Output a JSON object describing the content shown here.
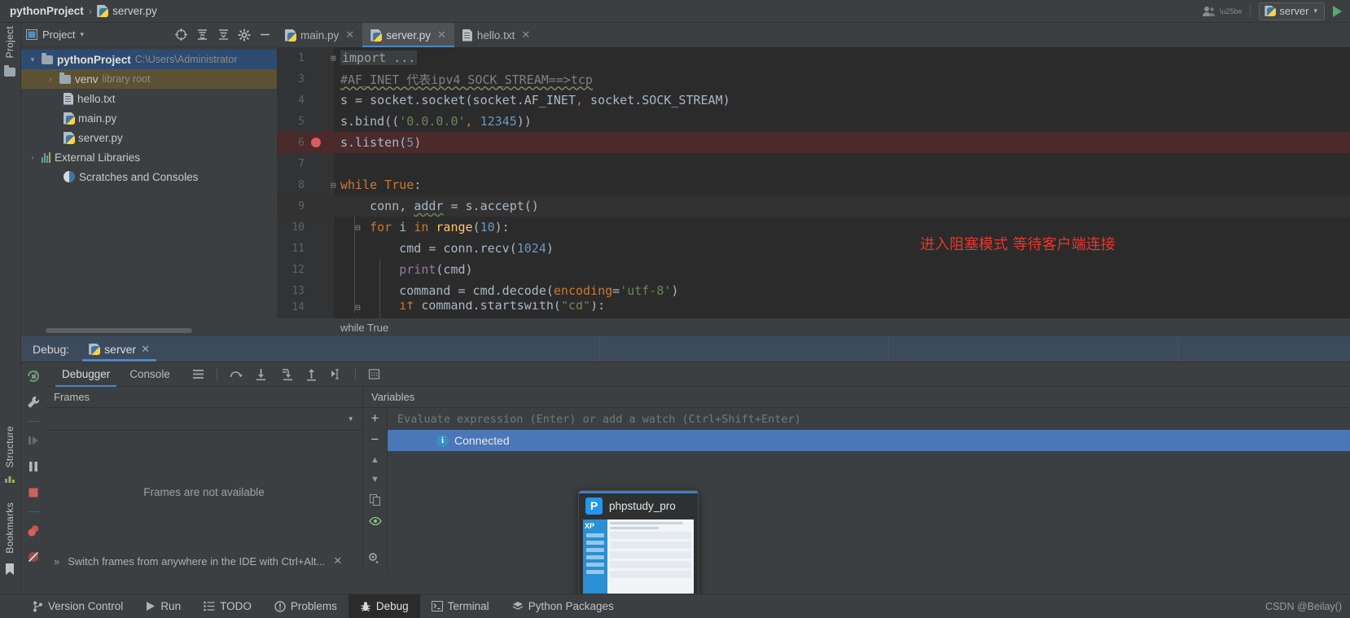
{
  "titlebar": {
    "project_name": "pythonProject",
    "separator": "›",
    "current_file": "server.py",
    "user_icon": "user-icon",
    "run_config": "server",
    "run_icon": "run-play-icon"
  },
  "left_rail": {
    "project_label": "Project",
    "structure_label": "Structure",
    "bookmarks_label": "Bookmarks"
  },
  "project_panel": {
    "title": "Project",
    "tools": [
      "locate-icon",
      "collapse-all-icon",
      "expand-icon",
      "settings-icon",
      "hide-icon"
    ],
    "tree": [
      {
        "label": "pythonProject",
        "detail": "C:\\Users\\Administrator",
        "icon": "folder-icon",
        "arrow": "⌄",
        "indent": 10,
        "state": "selected-blue",
        "bold": true
      },
      {
        "label": "venv",
        "detail": "library root",
        "icon": "folder-icon",
        "arrow": "›",
        "indent": 32,
        "state": "selected-tan",
        "bold": false
      },
      {
        "label": "hello.txt",
        "detail": "",
        "icon": "txt-file-icon",
        "arrow": "",
        "indent": 54,
        "state": "",
        "bold": false
      },
      {
        "label": "main.py",
        "detail": "",
        "icon": "py-file-icon",
        "arrow": "",
        "indent": 54,
        "state": "",
        "bold": false
      },
      {
        "label": "server.py",
        "detail": "",
        "icon": "py-file-icon",
        "arrow": "",
        "indent": 54,
        "state": "",
        "bold": false
      },
      {
        "label": "External Libraries",
        "detail": "",
        "icon": "libraries-icon",
        "arrow": "›",
        "indent": 10,
        "state": "",
        "bold": false
      },
      {
        "label": "Scratches and Consoles",
        "detail": "",
        "icon": "scratches-icon",
        "arrow": "",
        "indent": 32,
        "state": "",
        "bold": false
      }
    ]
  },
  "editor": {
    "tabs": [
      {
        "label": "main.py",
        "icon": "py-file-icon",
        "active": false
      },
      {
        "label": "server.py",
        "icon": "py-file-icon",
        "active": true
      },
      {
        "label": "hello.txt",
        "icon": "txt-file-icon",
        "active": false
      }
    ],
    "breadcrumb": "while True",
    "annotation": "进入阻塞模式 等待客户端连接",
    "annotation_color": "#e8352c",
    "lines": [
      {
        "num": "1",
        "text": "import ...",
        "state": "folded"
      },
      {
        "num": "3",
        "text": "#AF_INET 代表ipv4 SOCK_STREAM==>tcp",
        "state": "comment"
      },
      {
        "num": "4",
        "text": "s = socket.socket(socket.AF_INET, socket.SOCK_STREAM)",
        "state": ""
      },
      {
        "num": "5",
        "text": "s.bind(('0.0.0.0', 12345))",
        "state": ""
      },
      {
        "num": "6",
        "text": "s.listen(5)",
        "state": "breakpoint"
      },
      {
        "num": "7",
        "text": "",
        "state": ""
      },
      {
        "num": "8",
        "text": "while True:",
        "state": ""
      },
      {
        "num": "9",
        "text": "    conn, addr = s.accept()",
        "state": "current"
      },
      {
        "num": "10",
        "text": "    for i in range(10):",
        "state": ""
      },
      {
        "num": "11",
        "text": "        cmd = conn.recv(1024)",
        "state": ""
      },
      {
        "num": "12",
        "text": "        print(cmd)",
        "state": ""
      },
      {
        "num": "13",
        "text": "        command = cmd.decode(encoding='utf-8')",
        "state": ""
      },
      {
        "num": "14",
        "text": "        if command.startswith(\"cd\"):",
        "state": "clipped"
      }
    ]
  },
  "debug": {
    "panel_label": "Debug:",
    "session_tab": "server",
    "session_icon": "python-run-icon",
    "tabs": [
      {
        "label": "Debugger",
        "active": true
      },
      {
        "label": "Console",
        "active": false
      }
    ],
    "side_icons": [
      "rerun-icon",
      "wrench-icon",
      "resume-icon",
      "pause-icon",
      "stop-icon",
      "breakpoints-icon",
      "mute-breakpoints-icon"
    ],
    "toolbar_icons": [
      "layout-icon",
      "step-over-icon",
      "step-into-icon",
      "force-step-into-icon",
      "step-out-icon",
      "run-to-cursor-icon",
      "evaluate-icon"
    ],
    "frames_header": "Frames",
    "frames_empty": "Frames are not available",
    "variables_header": "Variables",
    "evaluate_placeholder": "Evaluate expression (Enter) or add a watch (Ctrl+Shift+Enter)",
    "connected_label": "Connected",
    "connected_icon": "info-icon",
    "hint": "Switch frames from anywhere in the IDE with Ctrl+Alt...",
    "hint_expand": "»",
    "vars_controls": [
      "add-watch-icon",
      "remove-watch-icon",
      "up-icon",
      "down-icon",
      "copy-icon",
      "eye-icon"
    ]
  },
  "statusbar": {
    "items": [
      {
        "label": "Version Control",
        "icon": "branch-icon",
        "active": false
      },
      {
        "label": "Run",
        "icon": "run-icon",
        "active": false
      },
      {
        "label": "TODO",
        "icon": "todo-icon",
        "active": false
      },
      {
        "label": "Problems",
        "icon": "problems-icon",
        "active": false
      },
      {
        "label": "Debug",
        "icon": "debug-bug-icon",
        "active": true
      },
      {
        "label": "Terminal",
        "icon": "terminal-icon",
        "active": false
      },
      {
        "label": "Python Packages",
        "icon": "packages-icon",
        "active": false
      }
    ],
    "watermark": "CSDN @Beilay()"
  },
  "popup": {
    "title": "phpstudy_pro",
    "icon_letter": "P",
    "thumb_label": "XP"
  },
  "colors": {
    "accent_blue": "#4a88c7",
    "selection_blue": "#4a77b8",
    "run_green": "#59a869",
    "breakpoint_red": "#db5c5c",
    "annotation_red": "#e8352c",
    "editor_bg": "#2b2b2b",
    "chrome_bg": "#3c3f41"
  }
}
